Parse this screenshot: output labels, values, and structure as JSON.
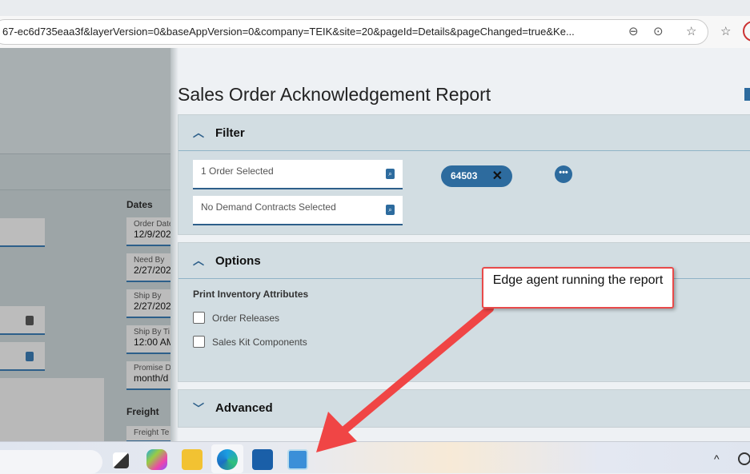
{
  "browser": {
    "url": "67-ec6d735eaa3f&layerVersion=0&baseAppVersion=0&company=TEIK&site=20&pageId=Details&pageChanged=true&Ke...",
    "icons": [
      "zoom-out-icon",
      "more-icon",
      "favorite-star-icon",
      "favorites-list-icon",
      "profile-icon"
    ]
  },
  "background_form": {
    "dates_heading": "Dates",
    "fields": [
      {
        "label": "Order Date",
        "value": "12/9/202"
      },
      {
        "label": "Need By",
        "value": "2/27/202"
      },
      {
        "label": "Ship By",
        "value": "2/27/202"
      },
      {
        "label": "Ship By Ti",
        "value": "12:00 AM"
      },
      {
        "label": "Promise D",
        "value": "month/d"
      }
    ],
    "freight_heading": "Freight",
    "freight_field": "Freight Te"
  },
  "report": {
    "title": "Sales Order Acknowledgement Report",
    "filter": {
      "label": "Filter",
      "order_input": "1 Order Selected",
      "contracts_input": "No Demand Contracts Selected",
      "chip": "64503"
    },
    "options": {
      "label": "Options",
      "group_label": "Print Inventory Attributes",
      "checkboxes": [
        {
          "label": "Order Releases",
          "checked": false
        },
        {
          "label": "Sales Kit Components",
          "checked": false
        }
      ]
    },
    "advanced": {
      "label": "Advanced"
    }
  },
  "annotation": {
    "callout": "Edge agent running the report",
    "color": "#e84a4a"
  },
  "taskbar": {
    "icons": [
      "task-view-icon",
      "copilot-icon",
      "file-explorer-icon",
      "edge-icon",
      "store-icon",
      "edge-agent-app-icon"
    ],
    "tray": "^"
  }
}
